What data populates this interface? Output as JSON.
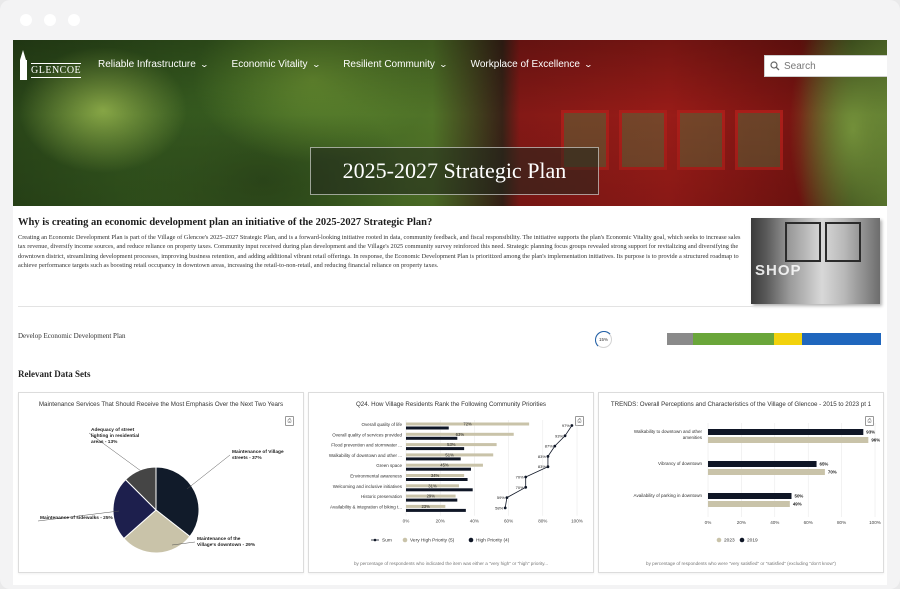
{
  "window": {
    "buttons": [
      "close",
      "minimize",
      "maximize"
    ]
  },
  "header": {
    "logo_text": "GLENCOE",
    "nav": [
      {
        "label": "Reliable Infrastructure"
      },
      {
        "label": "Economic Vitality"
      },
      {
        "label": "Resilient Community"
      },
      {
        "label": "Workplace of Excellence"
      }
    ],
    "search_placeholder": "Search",
    "hero_title": "2025-2027 Strategic Plan"
  },
  "intro": {
    "heading": "Why is creating an economic development plan an initiative of the 2025-2027 Strategic Plan?",
    "body": "Creating an Economic Development Plan is part of the Village of Glencoe's 2025–2027 Strategic Plan, and is a forward-looking initiative rooted in data, community feedback, and fiscal responsibility. The initiative supports the plan's Economic Vitality goal, which seeks to increase sales tax revenue, diversify income sources, and reduce reliance on property taxes. Community input received during plan development and the Village's 2025 community survey reinforced this need. Strategic planning focus groups revealed strong support for revitalizing and diversifying the downtown district, streamlining development processes, improving business retention, and adding additional vibrant retail offerings. In response, the Economic Development Plan is prioritized among the plan's implementation initiatives. Its purpose is to provide a structured roadmap to achieve performance targets such as boosting retail occupancy in downtown areas, increasing the retail-to-non-retail, and reducing financial reliance on property taxes.",
    "image_text": "SHOP"
  },
  "plan_row": {
    "label": "Develop Economic Development Plan",
    "percent": "15%",
    "segments": [
      {
        "color": "#8a8a8a",
        "share": 0.12
      },
      {
        "color": "#6aa63a",
        "share": 0.38
      },
      {
        "color": "#f2d20c",
        "share": 0.13
      },
      {
        "color": "#1f66bd",
        "share": 0.37
      }
    ]
  },
  "section_title": "Relevant Data Sets",
  "chart_data": [
    {
      "type": "pie",
      "title": "Maintenance Services That Should Receive the Most Emphasis Over the Next Two Years",
      "slices": [
        {
          "label": "Maintenance of Village streets",
          "value": 37,
          "display": "Maintenance of Village streets - 37%",
          "color": "#111b2a"
        },
        {
          "label": "Maintenance of the Village's downtown",
          "value": 29,
          "display": "Maintenance of the Village's downtown - 29%",
          "color": "#c9c3a9"
        },
        {
          "label": "Maintenance of sidewalks",
          "value": 25,
          "display": "Maintenance of sidewalks - 25%",
          "color": "#1d1f4d"
        },
        {
          "label": "Adequacy of street lighting in residential areas",
          "value": 13,
          "display": "Adequacy of street lighting in residential areas - 13%",
          "color": "#454545"
        }
      ]
    },
    {
      "type": "bar",
      "title": "Q24. How Village Residents Rank the Following Community Priorities",
      "categories": [
        "Overall quality of life",
        "Overall quality of services provided",
        "Flood prevention and stormwater ...",
        "Walkability of downtown and other ...",
        "Green space",
        "Environmental awareness",
        "Welcoming and inclusive initiatives",
        "Historic preservation",
        "Availability & integration of biking t..."
      ],
      "series": [
        {
          "name": "Very High Priority (5)",
          "color": "#c9c3a9",
          "values": [
            72,
            63,
            53,
            51,
            45,
            34,
            31,
            29,
            23
          ]
        },
        {
          "name": "High Priority (4)",
          "color": "#0f1626",
          "values": [
            25,
            30,
            34,
            32,
            38,
            36,
            39,
            30,
            35
          ]
        },
        {
          "name": "Sum",
          "color": "#0f1626",
          "values": [
            97,
            93,
            87,
            83,
            83,
            70,
            70,
            59,
            58
          ]
        }
      ],
      "sum_labels": [
        "97%",
        "93%",
        "87%",
        "83%",
        "83%",
        "70%",
        "70%",
        "59%",
        "58%"
      ],
      "xticks": [
        "0%",
        "20%",
        "40%",
        "60%",
        "80%",
        "100%"
      ],
      "xlim": [
        0,
        100
      ],
      "footnote": "by percentage of respondents who indicated the item was either a \"very high\" or \"high\" priority..."
    },
    {
      "type": "bar",
      "title": "TRENDS: Overall Perceptions and Characteristics of the Village of Glencoe - 2015 to 2023 pt 1",
      "categories": [
        "Walkability to downtown and other amenities",
        "Vibrancy of downtown",
        "Availability of parking in downtown"
      ],
      "series": [
        {
          "name": "2019",
          "color": "#0f1626",
          "values": [
            93,
            65,
            50
          ]
        },
        {
          "name": "2023",
          "color": "#c9c3a9",
          "values": [
            96,
            70,
            49
          ]
        }
      ],
      "labels_2019": [
        "93%",
        "65%",
        "50%"
      ],
      "labels_2023": [
        "96%",
        "70%",
        "49%"
      ],
      "xticks": [
        "0%",
        "20%",
        "40%",
        "60%",
        "80%",
        "100%"
      ],
      "xlim": [
        0,
        100
      ],
      "legend_order": [
        "2023",
        "2019"
      ],
      "footnote": "by percentage of respondents who were \"very satisfied\" or \"satisfied\" (excluding \"don't know\")"
    }
  ]
}
